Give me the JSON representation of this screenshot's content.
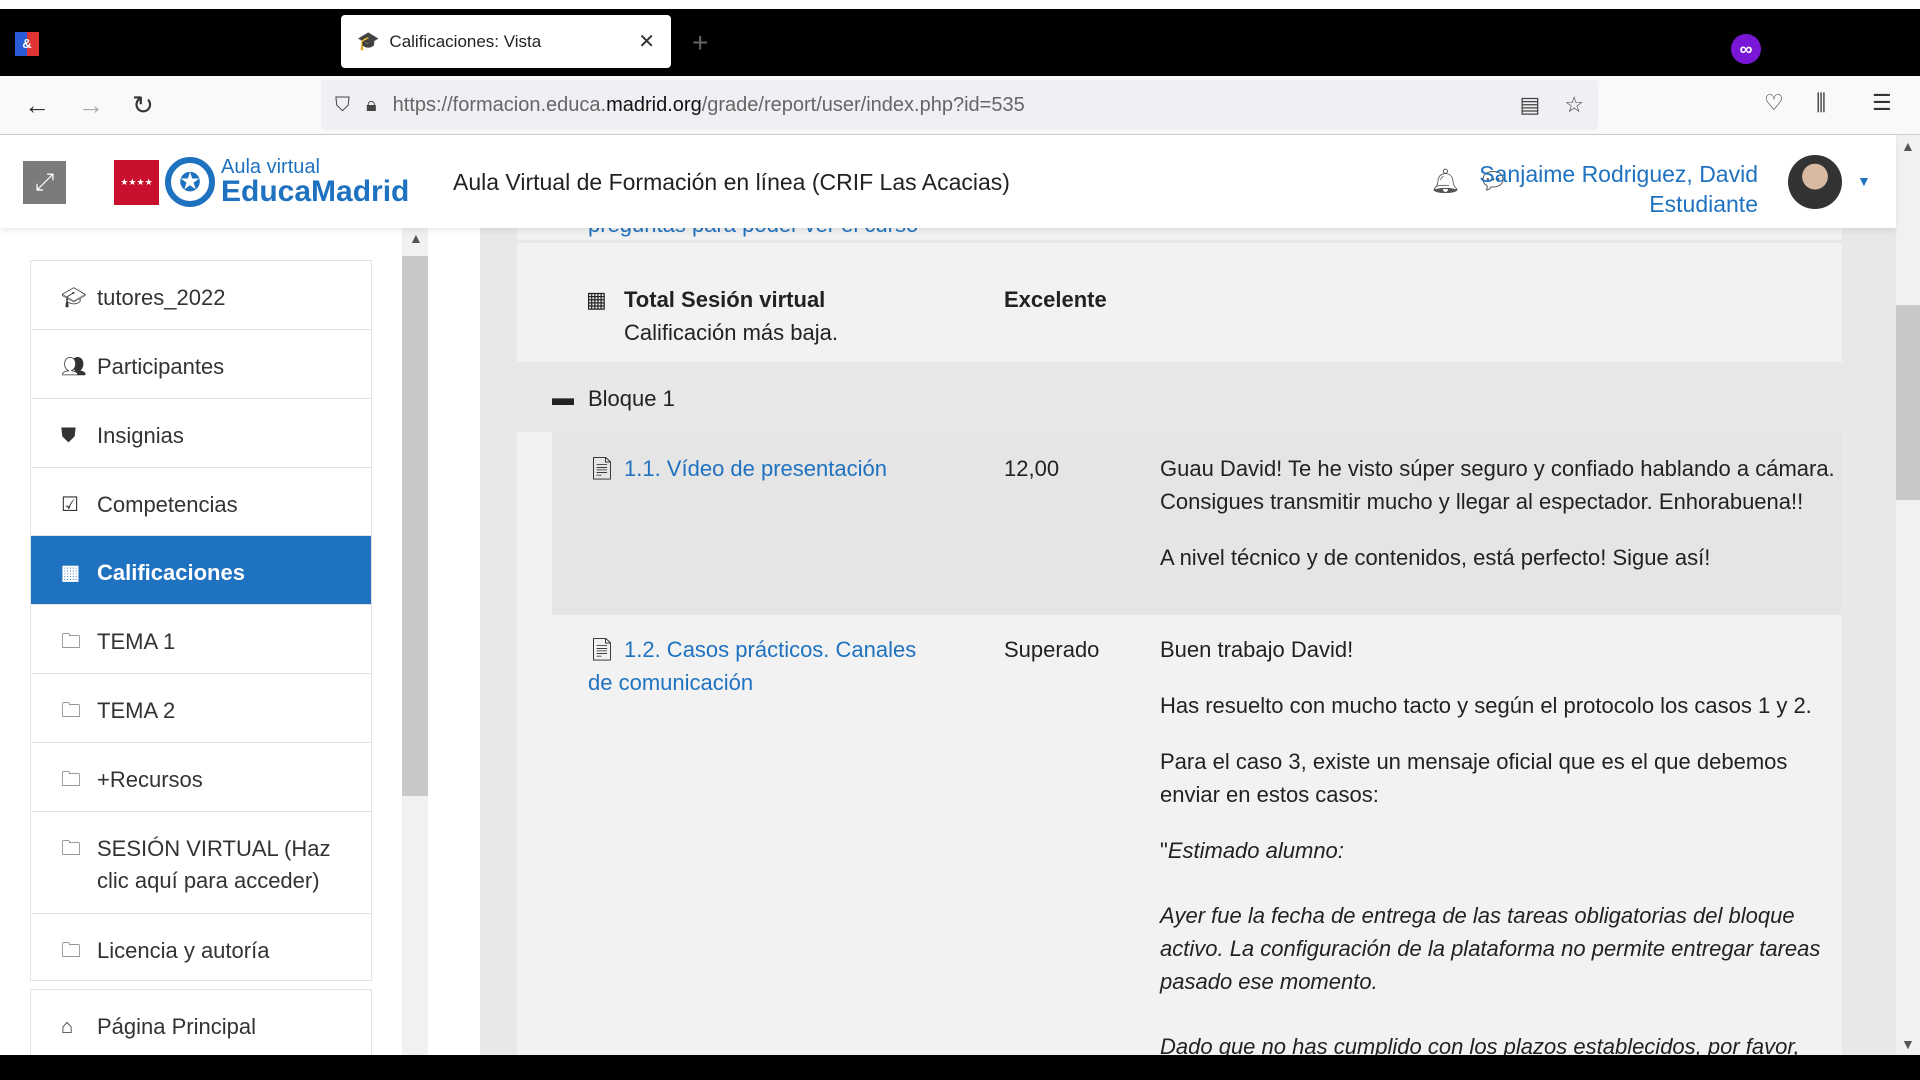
{
  "browser": {
    "tab_title": "Calificaciones: Vista",
    "url_prefix": "https://formacion.educa.",
    "url_domain": "madrid.org",
    "url_suffix": "/grade/report/user/index.php?id=535"
  },
  "header": {
    "logo_small": "Aula virtual",
    "logo_big": "EducaMadrid",
    "site_title": "Aula Virtual de Formación en línea (CRIF Las Acacias)",
    "user_name": "Sanjaime Rodriguez, David",
    "user_role": "Estudiante"
  },
  "sidebar": {
    "items": [
      {
        "label": "tutores_2022",
        "icon": "graduation-cap-icon"
      },
      {
        "label": "Participantes",
        "icon": "users-icon"
      },
      {
        "label": "Insignias",
        "icon": "shield-icon"
      },
      {
        "label": "Competencias",
        "icon": "checkbox-icon"
      },
      {
        "label": "Calificaciones",
        "icon": "table-icon",
        "active": true
      },
      {
        "label": "TEMA 1",
        "icon": "folder-icon"
      },
      {
        "label": "TEMA 2",
        "icon": "folder-icon"
      },
      {
        "label": "+Recursos",
        "icon": "folder-icon"
      },
      {
        "label": "SESIÓN VIRTUAL (Haz clic aquí para acceder)",
        "icon": "folder-icon"
      },
      {
        "label": "Licencia y autoría",
        "icon": "folder-icon"
      },
      {
        "label": "Página Principal",
        "icon": "home-icon"
      }
    ]
  },
  "grades": {
    "partial_link": "preguntas para poder ver el curso",
    "total": {
      "name": "Total Sesión virtual",
      "sub": "Calificación más baja.",
      "grade": "Excelente"
    },
    "category": "Bloque 1",
    "items": [
      {
        "name": "1.1. Vídeo de presentación",
        "grade": "12,00",
        "feedback": [
          "Guau David! Te he visto súper seguro y confiado hablando a cámara. Consigues transmitir mucho y llegar al espectador. Enhorabuena!!",
          "A nivel técnico y de contenidos, está perfecto! Sigue así!"
        ]
      },
      {
        "name": "1.2. Casos prácticos. Canales de comunicación",
        "grade": "Superado",
        "feedback": [
          "Buen trabajo David!",
          "Has resuelto con mucho tacto y según el protocolo los casos 1 y 2.",
          "Para el caso 3, existe un mensaje oficial que es el que debemos enviar en estos casos:",
          "Estimado alumno:",
          "Ayer fue la fecha de entrega de las tareas obligatorias del bloque activo. La configuración de la plataforma no permite entregar tareas pasado ese momento.",
          "Dado que no has cumplido con los plazos establecidos, por favor,"
        ]
      }
    ]
  },
  "colors": {
    "accent": "#1f72c0"
  }
}
